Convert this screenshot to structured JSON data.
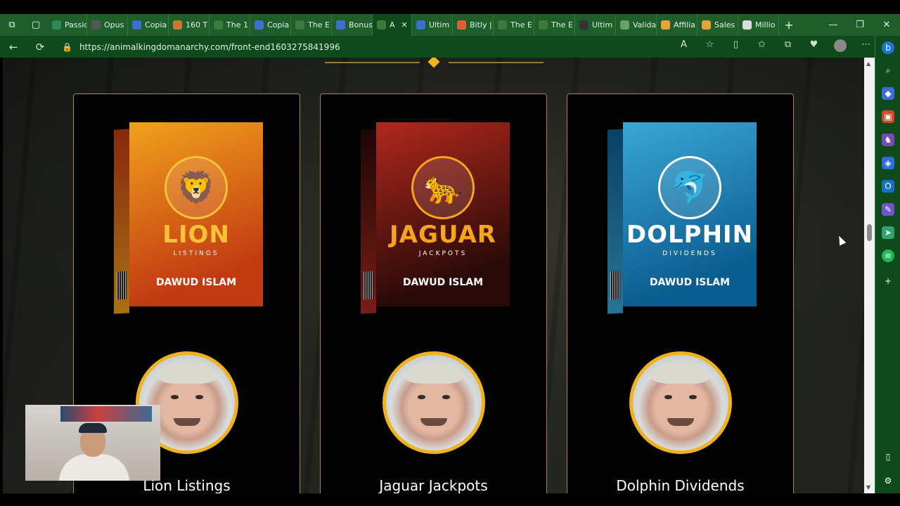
{
  "browser": {
    "tabs": [
      {
        "label": "Passic",
        "color": "#2e8b57"
      },
      {
        "label": "Opus",
        "color": "#555555"
      },
      {
        "label": "Copia",
        "color": "#3b6fd1"
      },
      {
        "label": "160 T",
        "color": "#c97a2b"
      },
      {
        "label": "The 1",
        "color": "#3b7a3b"
      },
      {
        "label": "Copia",
        "color": "#3b6fd1"
      },
      {
        "label": "The E",
        "color": "#3b7a3b"
      },
      {
        "label": "Bonus",
        "color": "#3b6fd1"
      },
      {
        "label": "A",
        "color": "#3b7a3b",
        "active": true
      },
      {
        "label": "Ultim",
        "color": "#3b6fd1"
      },
      {
        "label": "Bitly |",
        "color": "#e06030"
      },
      {
        "label": "The E",
        "color": "#3b7a3b"
      },
      {
        "label": "The E",
        "color": "#3b7a3b"
      },
      {
        "label": "Ultim",
        "color": "#333333"
      },
      {
        "label": "Valida",
        "color": "#6aa36a"
      },
      {
        "label": "Affilia",
        "color": "#e8a33a"
      },
      {
        "label": "Sales",
        "color": "#e8a33a"
      },
      {
        "label": "Millio",
        "color": "#dddddd"
      }
    ],
    "url": "https://animalkingdomanarchy.com/front-end1603275841996",
    "icons": {
      "workspaces": "workspaces-icon",
      "tab_actions": "tab-actions-icon",
      "new_tab": "plus-icon",
      "minimize": "minimize-icon",
      "restore": "restore-icon",
      "close": "close-icon",
      "back": "back-icon",
      "refresh": "refresh-icon",
      "lock": "lock-icon",
      "read_aloud": "read-aloud-icon",
      "favorite": "star-icon",
      "split": "split-screen-icon",
      "favorites": "favorites-icon",
      "collections": "collections-icon",
      "extensions": "extensions-icon",
      "profile": "profile-icon",
      "more": "more-icon",
      "bing": "bing-icon"
    }
  },
  "products": [
    {
      "title": "Lion Listings",
      "box_word": "LION",
      "box_sub": "LISTINGS",
      "box_author": "DAWUD ISLAM",
      "emblem": "🦁",
      "box_color_a": "#c23a12",
      "box_color_b": "#f1a11c",
      "word_color": "#f6c23a"
    },
    {
      "title": "Jaguar Jackpots",
      "box_word": "JAGUAR",
      "box_sub": "JACKPOTS",
      "box_author": "DAWUD ISLAM",
      "emblem": "🐆",
      "box_color_a": "#2a0a08",
      "box_color_b": "#b0281c",
      "word_color": "#f4a51c"
    },
    {
      "title": "Dolphin Dividends",
      "box_word": "DOLPHIN",
      "box_sub": "DIVIDENDS",
      "box_author": "DAWUD ISLAM",
      "emblem": "🐬",
      "box_color_a": "#0c5d8f",
      "box_color_b": "#39a7d6",
      "word_color": "#ffffff"
    }
  ],
  "accent": "#f0b31e"
}
